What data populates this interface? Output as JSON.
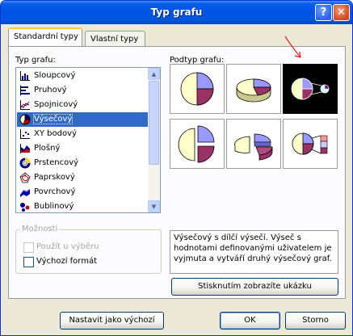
{
  "window": {
    "title": "Typ grafu"
  },
  "tabs": [
    {
      "label": "Standardní typy",
      "active": true
    },
    {
      "label": "Vlastní typy",
      "active": false
    }
  ],
  "chart_type": {
    "label": "Typ grafu:",
    "items": [
      {
        "label": "Sloupcový",
        "icon": "column-chart-icon"
      },
      {
        "label": "Pruhový",
        "icon": "bar-chart-icon"
      },
      {
        "label": "Spojnicový",
        "icon": "line-chart-icon"
      },
      {
        "label": "Výsečový",
        "icon": "pie-chart-icon",
        "selected": true
      },
      {
        "label": "XY bodový",
        "icon": "scatter-chart-icon"
      },
      {
        "label": "Plošný",
        "icon": "area-chart-icon"
      },
      {
        "label": "Prstencový",
        "icon": "doughnut-chart-icon"
      },
      {
        "label": "Paprskový",
        "icon": "radar-chart-icon"
      },
      {
        "label": "Povrchový",
        "icon": "surface-chart-icon"
      },
      {
        "label": "Bublinový",
        "icon": "bubble-chart-icon"
      }
    ]
  },
  "subtype": {
    "label": "Podtyp grafu:",
    "selected_index": 2
  },
  "options": {
    "label": "Možnosti",
    "apply_to_selection": "Použít u výběru",
    "default_format": "Výchozí formát"
  },
  "description": "Výsečový s dílčí výsečí. Výseč s hodnotami definovanými uživatelem je vyjmuta a vytváří druhý výsečový graf.",
  "buttons": {
    "preview": "Stisknutím zobrazíte ukázku",
    "set_default": "Nastavit jako výchozí",
    "ok": "OK",
    "cancel": "Storno"
  },
  "colors": {
    "title_bar": "#0054e3",
    "selection": "#316ac5",
    "pie_lavender": "#9999ff",
    "pie_maroon": "#993366",
    "pie_cream": "#ffffcc",
    "annotation_red": "#e02020"
  }
}
